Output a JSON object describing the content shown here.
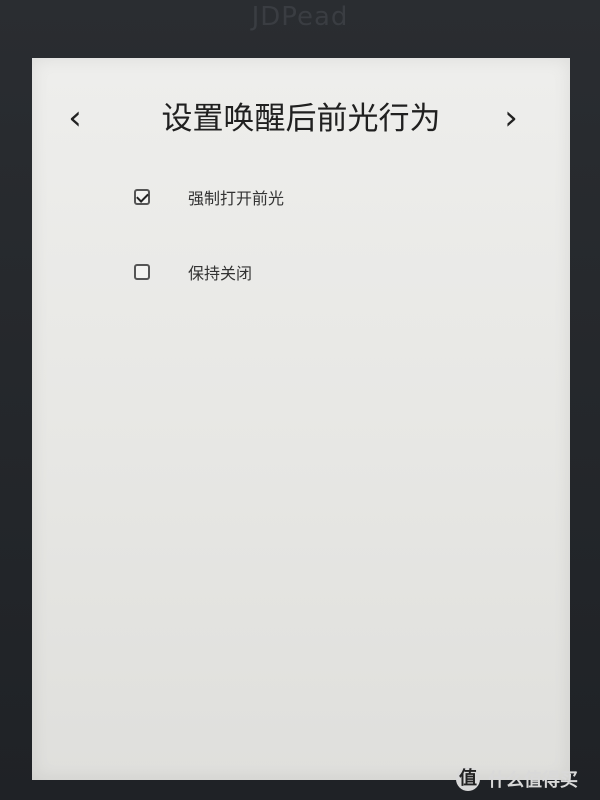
{
  "device": {
    "brand": "JDPead"
  },
  "header": {
    "title": "设置唤醒后前光行为",
    "prev_icon": "‹",
    "next_icon": "›"
  },
  "options": [
    {
      "label": "强制打开前光",
      "checked": true
    },
    {
      "label": "保持关闭",
      "checked": false
    }
  ],
  "watermark": {
    "badge": "值",
    "text": "什么值得买"
  },
  "colors": {
    "screen_bg": "#eeeeec",
    "text": "#202020",
    "border": "#555555"
  }
}
